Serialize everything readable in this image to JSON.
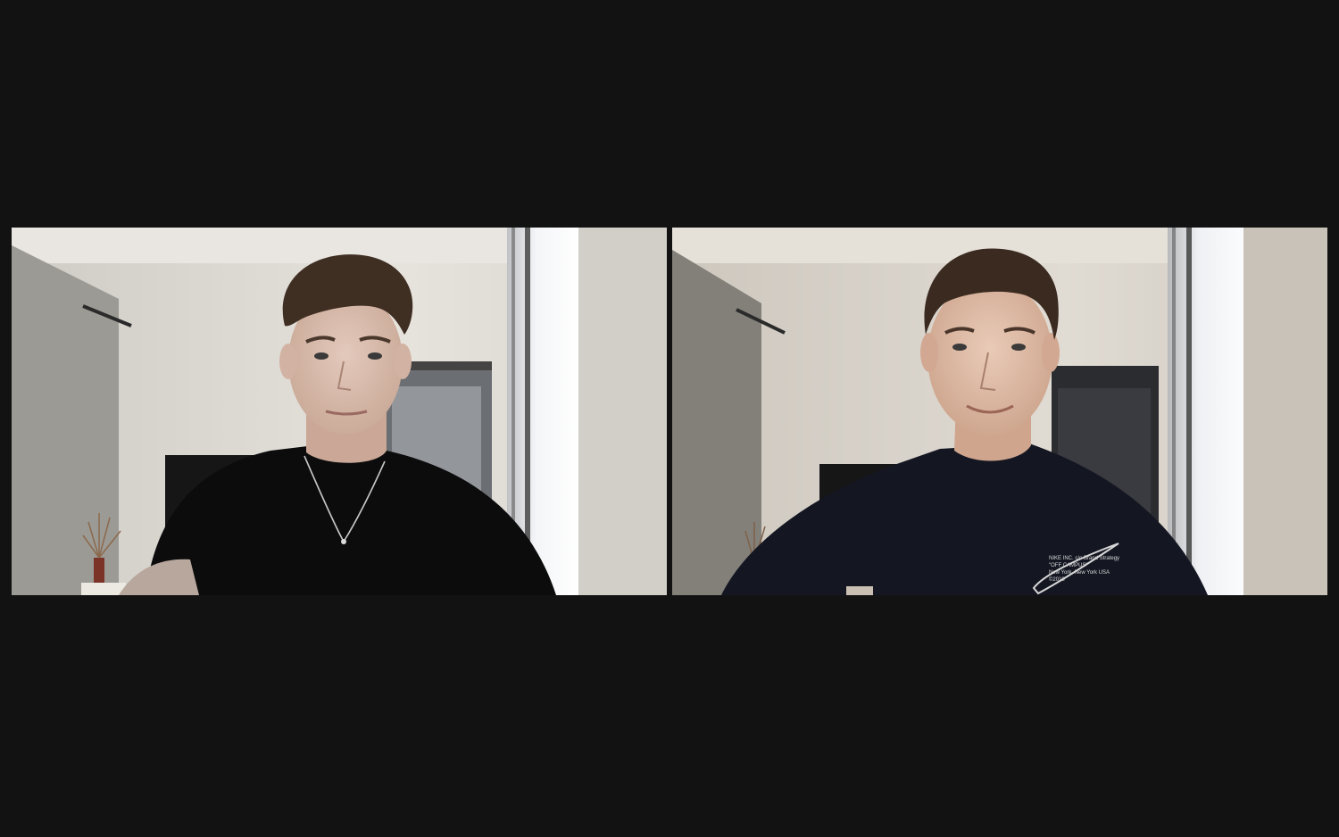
{
  "meeting": {
    "layout": "gallery-view",
    "background_color": "#121212"
  },
  "participants": [
    {
      "id": "left",
      "video": "camera-feed",
      "shirt_color": "#0c0c0d",
      "wall_color": "#e3dfd9"
    },
    {
      "id": "right",
      "video": "camera-feed",
      "shirt_color": "#141722",
      "wall_color": "#dcd6ce",
      "shirt_print": {
        "logo": "swoosh-logo",
        "lines": [
          "NIKE INC. c/o Brand Strategy",
          "\"OFF CAMPUS\"",
          "New York, New York USA",
          "©2018"
        ]
      }
    }
  ]
}
